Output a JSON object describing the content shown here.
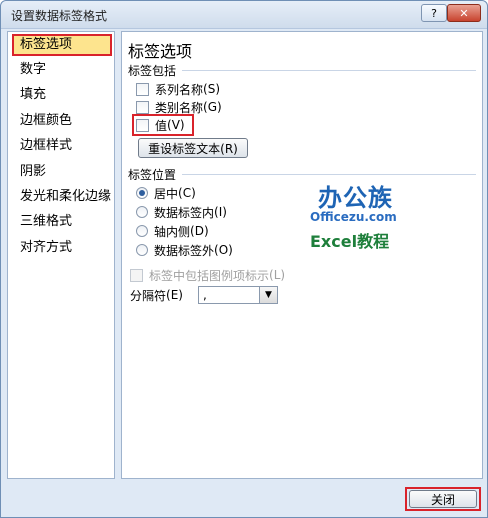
{
  "window": {
    "title": "设置数据标签格式",
    "help_label": "?",
    "close_label": "✕"
  },
  "nav": {
    "items": [
      {
        "label": "标签选项",
        "selected": true
      },
      {
        "label": "数字"
      },
      {
        "label": "填充"
      },
      {
        "label": "边框颜色"
      },
      {
        "label": "边框样式"
      },
      {
        "label": "阴影"
      },
      {
        "label": "发光和柔化边缘"
      },
      {
        "label": "三维格式"
      },
      {
        "label": "对齐方式"
      }
    ]
  },
  "panel": {
    "title": "标签选项",
    "contains": {
      "heading": "标签包括",
      "series_name": {
        "label": "系列名称",
        "key": "(S)",
        "checked": false
      },
      "category_name": {
        "label": "类别名称",
        "key": "(G)",
        "checked": false
      },
      "value": {
        "label": "值",
        "key": "(V)",
        "checked": false
      },
      "reset_button": "重设标签文本(R)"
    },
    "position": {
      "heading": "标签位置",
      "options": [
        {
          "label": "居中",
          "key": "(C)",
          "selected": true
        },
        {
          "label": "数据标签内",
          "key": "(I)",
          "selected": false
        },
        {
          "label": "轴内侧",
          "key": "(D)",
          "selected": false
        },
        {
          "label": "数据标签外",
          "key": "(O)",
          "selected": false
        }
      ]
    },
    "legend_key": {
      "label": "标签中包括图例项标示",
      "key": "(L)",
      "checked": false,
      "enabled": false
    },
    "separator": {
      "label": "分隔符",
      "key": "(E)",
      "value": ","
    }
  },
  "watermark": {
    "cn": "办公族",
    "url": "Officezu.com",
    "excel": "Excel教程"
  },
  "footer": {
    "close_label": "关闭"
  }
}
